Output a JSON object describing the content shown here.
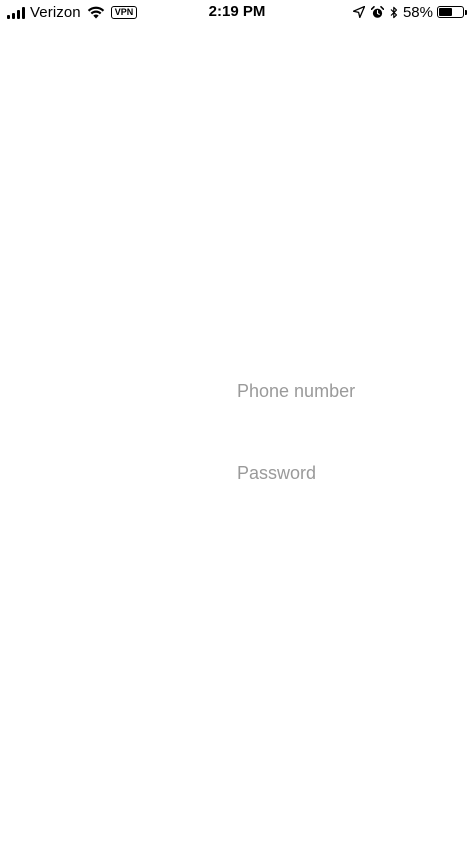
{
  "status_bar": {
    "carrier": "Verizon",
    "vpn": "VPN",
    "time": "2:19 PM",
    "battery_percent": "58%",
    "battery_level": 0.58,
    "signal_bars": 4,
    "icons": [
      "signal-icon",
      "wifi-icon",
      "vpn-badge",
      "location-arrow-icon",
      "alarm-icon",
      "bluetooth-icon",
      "battery-icon"
    ]
  },
  "login": {
    "phone_placeholder": "Phone number",
    "phone_value": "",
    "password_placeholder": "Password",
    "password_value": ""
  }
}
